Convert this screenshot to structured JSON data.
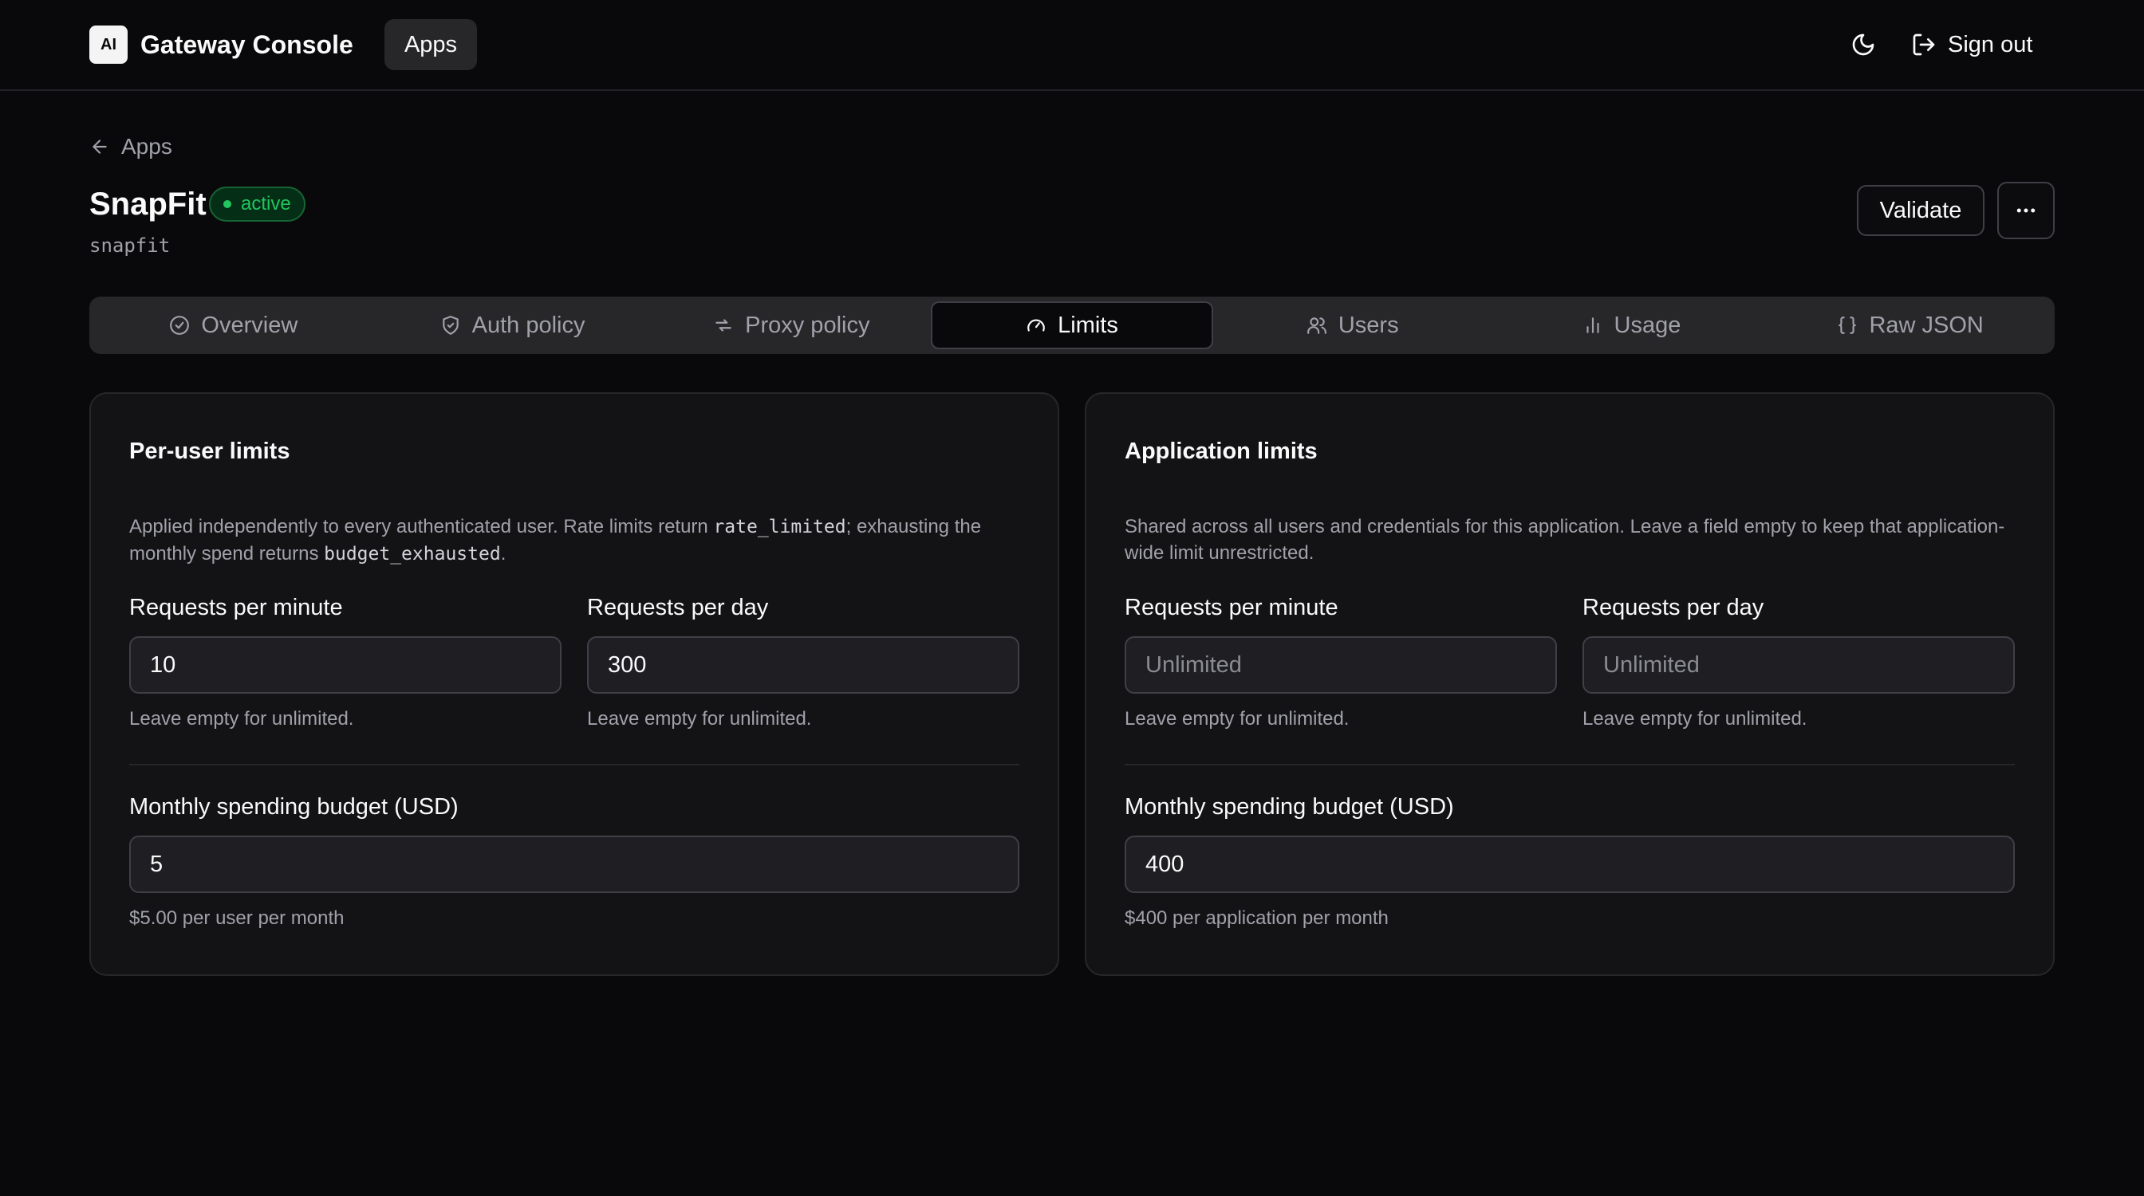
{
  "header": {
    "logo_text": "AI",
    "brand": "Gateway Console",
    "nav_apps": "Apps",
    "sign_out": "Sign out"
  },
  "page": {
    "back_label": "Apps",
    "title": "SnapFit",
    "status": "active",
    "slug": "snapfit",
    "validate_label": "Validate"
  },
  "tabs": [
    {
      "label": "Overview",
      "icon": "check-circle-icon"
    },
    {
      "label": "Auth policy",
      "icon": "shield-check-icon"
    },
    {
      "label": "Proxy policy",
      "icon": "arrows-icon"
    },
    {
      "label": "Limits",
      "icon": "gauge-icon",
      "active": true
    },
    {
      "label": "Users",
      "icon": "users-icon"
    },
    {
      "label": "Usage",
      "icon": "bar-chart-icon"
    },
    {
      "label": "Raw JSON",
      "icon": "braces-icon"
    }
  ],
  "per_user": {
    "title": "Per-user limits",
    "desc_1": "Applied independently to every authenticated user. Rate limits return ",
    "desc_code_1": "rate_limited",
    "desc_2": "; exhausting the monthly spend returns ",
    "desc_code_2": "budget_exhausted",
    "desc_3": ".",
    "rpm_label": "Requests per minute",
    "rpm_value": "10",
    "rpm_hint": "Leave empty for unlimited.",
    "rpd_label": "Requests per day",
    "rpd_value": "300",
    "rpd_hint": "Leave empty for unlimited.",
    "budget_label": "Monthly spending budget (USD)",
    "budget_value": "5",
    "budget_hint": "$5.00 per user per month"
  },
  "application": {
    "title": "Application limits",
    "desc": "Shared across all users and credentials for this application. Leave a field empty to keep that application-wide limit unrestricted.",
    "rpm_label": "Requests per minute",
    "rpm_placeholder": "Unlimited",
    "rpm_hint": "Leave empty for unlimited.",
    "rpd_label": "Requests per day",
    "rpd_placeholder": "Unlimited",
    "rpd_hint": "Leave empty for unlimited.",
    "budget_label": "Monthly spending budget (USD)",
    "budget_value": "400",
    "budget_hint": "$400 per application per month"
  },
  "colors": {
    "background": "#09090b",
    "card": "#131316",
    "accent_success": "#22c55e"
  }
}
